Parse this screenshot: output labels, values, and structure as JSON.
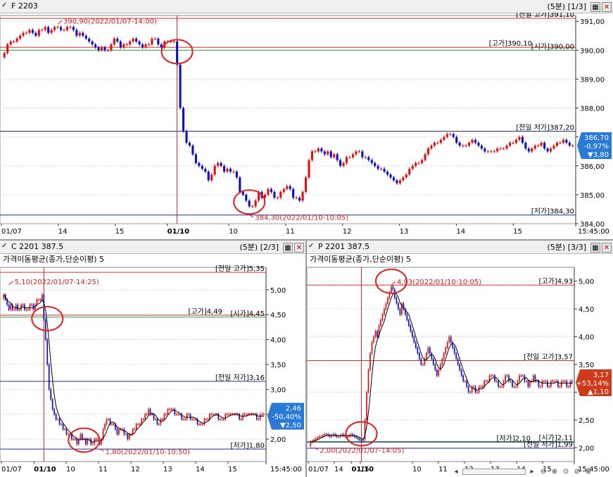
{
  "colors": {
    "up": "#e01010",
    "down": "#1010c0",
    "grid": "#c8c8c8",
    "hline_red": "#e03030",
    "hline_blue": "#2030a0",
    "hline_green": "#30a030",
    "vline": "#d02020",
    "circle": "#e02020",
    "badge_down": "#2979d6",
    "badge_up": "#d03a1a",
    "ma": "#000000"
  },
  "panels": [
    {
      "id": "f2203",
      "title": "F 2203",
      "period": "(5분)",
      "page": "[1/3]",
      "legend": "",
      "ylim": [
        384.0,
        391.2
      ],
      "yticks": [
        384.0,
        385.0,
        386.0,
        387.0,
        388.0,
        389.0,
        390.0,
        391.0
      ],
      "ytick_labels": [
        "384,00",
        "385,00",
        "386,00",
        "387,00",
        "388,00",
        "389,00",
        "390,00",
        "391,00"
      ],
      "xlabels": [
        "01/07",
        "14",
        "15",
        "01/10",
        "10",
        "11",
        "12",
        "13",
        "14",
        "15",
        "15:45:00"
      ],
      "xlabel_bold_index": 3,
      "n_candles": 180,
      "vline_index": 55,
      "hlines": [
        {
          "value": 391.1,
          "color": "hline_red",
          "label": "[전일 고가]391,10"
        },
        {
          "value": 390.1,
          "color": "hline_red",
          "label": "[고가]390,10"
        },
        {
          "value": 390.0,
          "color": "hline_green",
          "label": "[시가]390,00"
        },
        {
          "value": 387.2,
          "color": "hline_blue",
          "label": "[전일 저가]387,20"
        },
        {
          "value": 384.3,
          "color": "hline_blue",
          "label": "[저가]384,30"
        }
      ],
      "annotations": [
        {
          "text": "390,90(2022/01/07-14:00)",
          "at": 17,
          "value": 390.9,
          "side": "above"
        },
        {
          "text": "384,30(2022/01/10-10:05)",
          "at": 78,
          "value": 384.3,
          "side": "below"
        }
      ],
      "circles": [
        {
          "at": 55,
          "value": 389.95
        },
        {
          "at": 78,
          "value": 384.75
        }
      ],
      "badge": {
        "lines": [
          "386,70",
          "-0,97%",
          "▼3,80"
        ],
        "value": 386.7,
        "style": "badge_down"
      },
      "chart_data": {
        "type": "candlestick",
        "series": [
          {
            "values": [
              389.9,
              390.2,
              390.3,
              390.3,
              390.4,
              390.5,
              390.6,
              390.6,
              390.7,
              390.6,
              390.5,
              390.7,
              390.7,
              390.8,
              390.6,
              390.7,
              390.8,
              390.8,
              390.7,
              390.7,
              390.8,
              390.8,
              390.7,
              390.5,
              390.6,
              390.5,
              390.4,
              390.3,
              390.2,
              390.1,
              390.0,
              390.1,
              390.0,
              390.0,
              390.2,
              390.4,
              390.3,
              390.1,
              390.2,
              390.2,
              390.3,
              390.4,
              390.3,
              390.2,
              390.1,
              390.2,
              390.2,
              390.4,
              390.4,
              390.2,
              390.1,
              390.3,
              390.3,
              390.3,
              390.3,
              389.5,
              388.0,
              387.2,
              386.8,
              386.7,
              386.4,
              386.1,
              386.0,
              385.9,
              385.8,
              385.5,
              385.7,
              386.0,
              386.1,
              386.0,
              385.8,
              385.9,
              385.8,
              385.8,
              385.6,
              385.1,
              385.0,
              384.8,
              384.6,
              384.6,
              384.8,
              385.1,
              384.9,
              385.0,
              385.2,
              385.1,
              384.9,
              384.9,
              385.1,
              385.2,
              385.3,
              385.2,
              384.9,
              384.9,
              384.8,
              385.1,
              385.6,
              386.2,
              386.5,
              386.5,
              386.6,
              386.5,
              386.4,
              386.5,
              386.3,
              386.4,
              386.2,
              386.0,
              386.1,
              386.3,
              386.3,
              386.4,
              386.5,
              386.5,
              386.3,
              386.3,
              386.2,
              386.1,
              386.0,
              385.9,
              385.9,
              385.8,
              385.7,
              385.6,
              385.5,
              385.4,
              385.5,
              385.6,
              385.7,
              385.9,
              386.0,
              386.1,
              386.1,
              386.2,
              386.4,
              386.6,
              386.7,
              386.8,
              386.8,
              386.9,
              387.0,
              387.1,
              387.1,
              387.0,
              386.8,
              386.7,
              386.7,
              386.7,
              386.8,
              386.9,
              386.8,
              386.7,
              386.6,
              386.5,
              386.5,
              386.5,
              386.5,
              386.6,
              386.6,
              386.6,
              386.7,
              386.8,
              386.8,
              386.9,
              387.0,
              386.8,
              386.6,
              386.5,
              386.6,
              386.7,
              386.7,
              386.8,
              386.6,
              386.5,
              386.6,
              386.7,
              386.8,
              386.8,
              386.9,
              386.8,
              386.7,
              386.7
            ]
          }
        ]
      }
    },
    {
      "id": "c2201",
      "title": "C 2201  387.5",
      "period": "(5분)",
      "page": "[2/3]",
      "legend": "가격이동평균(종가,단순이평) 5",
      "ylim": [
        1.55,
        5.45
      ],
      "yticks": [
        2.0,
        2.5,
        3.0,
        3.5,
        4.0,
        4.5,
        5.0
      ],
      "ytick_labels": [
        "2,00",
        "2,50",
        "3,00",
        "3,50",
        "4,00",
        "4,50",
        "5,00"
      ],
      "xlabels": [
        "01/07",
        "01/10",
        "10",
        "11",
        "12",
        "13",
        "14",
        "15",
        "15:45:00"
      ],
      "xlabel_bold_index": 1,
      "n_candles": 150,
      "vline_index": 23,
      "hlines": [
        {
          "value": 5.35,
          "color": "hline_red",
          "label": "[전일 고가]5,35"
        },
        {
          "value": 4.49,
          "color": "hline_red",
          "label": "[고가]4,49"
        },
        {
          "value": 4.45,
          "color": "hline_green",
          "label": "[시가]4,45"
        },
        {
          "value": 3.16,
          "color": "hline_blue",
          "label": "[전일 저가]3,16"
        },
        {
          "value": 1.8,
          "color": "hline_blue",
          "label": "[저가]1,80"
        }
      ],
      "annotations": [
        {
          "text": "5,10(2022/01/07-14:25)",
          "at": 3,
          "value": 5.1,
          "side": "above"
        },
        {
          "text": "1,80(2022/01/10-10:50)",
          "at": 55,
          "value": 1.8,
          "side": "below"
        }
      ],
      "circles": [
        {
          "at": 25,
          "value": 4.42
        },
        {
          "at": 46,
          "value": 1.98
        }
      ],
      "badge": {
        "lines": [
          "2,46",
          "-50,40%",
          "▼2,50"
        ],
        "value": 2.46,
        "style": "badge_down"
      },
      "chart_data": {
        "type": "candlestick",
        "series": [
          {
            "values": [
              4.9,
              4.8,
              4.7,
              4.6,
              4.7,
              4.6,
              4.6,
              4.7,
              4.6,
              4.6,
              4.7,
              4.7,
              4.6,
              4.6,
              4.6,
              4.7,
              4.7,
              4.6,
              4.7,
              4.8,
              4.8,
              4.8,
              4.9,
              4.4,
              4.0,
              3.5,
              3.0,
              2.8,
              2.6,
              2.5,
              2.4,
              2.4,
              2.3,
              2.3,
              2.2,
              2.2,
              2.1,
              2.1,
              2.1,
              2.0,
              2.0,
              2.0,
              1.9,
              2.0,
              2.1,
              2.0,
              2.0,
              1.9,
              2.0,
              2.0,
              1.9,
              1.9,
              2.0,
              2.0,
              2.0,
              1.9,
              2.0,
              2.2,
              2.3,
              2.4,
              2.4,
              2.3,
              2.3,
              2.3,
              2.2,
              2.1,
              2.2,
              2.2,
              2.2,
              2.1,
              2.1,
              2.0,
              2.1,
              2.1,
              2.2,
              2.2,
              2.3,
              2.3,
              2.3,
              2.4,
              2.4,
              2.5,
              2.5,
              2.6,
              2.5,
              2.5,
              2.4,
              2.4,
              2.3,
              2.3,
              2.4,
              2.4,
              2.5,
              2.5,
              2.6,
              2.6,
              2.6,
              2.6,
              2.5,
              2.5,
              2.5,
              2.5,
              2.4,
              2.4,
              2.4,
              2.5,
              2.5,
              2.4,
              2.4,
              2.4,
              2.4,
              2.3,
              2.3,
              2.3,
              2.3,
              2.4,
              2.4,
              2.4,
              2.5,
              2.5,
              2.5,
              2.5,
              2.5,
              2.4,
              2.4,
              2.4,
              2.4,
              2.5,
              2.5,
              2.5,
              2.5,
              2.5,
              2.5,
              2.5,
              2.5,
              2.4,
              2.4,
              2.5,
              2.5,
              2.5,
              2.5,
              2.5,
              2.5,
              2.5,
              2.5,
              2.4,
              2.4,
              2.5,
              2.5,
              2.5
            ]
          }
        ]
      }
    },
    {
      "id": "p2201",
      "title": "P 2201  387.5",
      "period": "(5분)",
      "page": "[3/3]",
      "legend": "가격이동평균(종가,단순이평) 5",
      "ylim": [
        1.75,
        5.25
      ],
      "yticks": [
        2.0,
        2.5,
        3.0,
        3.5,
        4.0,
        4.5,
        5.0
      ],
      "ytick_labels": [
        "2,00",
        "2,50",
        "3,00",
        "3,50",
        "4,00",
        "4,50",
        "5,00"
      ],
      "xlabels": [
        "01/07",
        "14",
        "15",
        "01/10",
        "10",
        "11",
        "12",
        "13",
        "14",
        "15",
        "15:45:00"
      ],
      "xlabel_bold_index": 3,
      "n_candles": 150,
      "vline_index": 29,
      "hlines": [
        {
          "value": 4.93,
          "color": "hline_red",
          "label": "[고가]4,93"
        },
        {
          "value": 3.57,
          "color": "hline_red",
          "label": "[전일 고가]3,57"
        },
        {
          "value": 2.11,
          "color": "hline_green",
          "label": "[시가]2,11"
        },
        {
          "value": 2.1,
          "color": "hline_blue",
          "label": "[저가]2,10"
        },
        {
          "value": 1.99,
          "color": "hline_blue",
          "label": "[전일 저가]1,99"
        }
      ],
      "annotations": [
        {
          "text": "4,93(2022/01/10-10:05)",
          "at": 46,
          "value": 4.93,
          "side": "above"
        },
        {
          "text": "2,00(2022/01/07-14:05)",
          "at": 2,
          "value": 2.0,
          "side": "below"
        }
      ],
      "circles": [
        {
          "at": 29,
          "value": 2.25
        },
        {
          "at": 46,
          "value": 5.0
        }
      ],
      "badge": {
        "lines": [
          "3,17",
          "+53,14%",
          "▲1,10"
        ],
        "value": 3.17,
        "style": "badge_up"
      },
      "chart_data": {
        "type": "candlestick",
        "series": [
          {
            "values": [
              2.1,
              2.12,
              2.14,
              2.16,
              2.18,
              2.2,
              2.2,
              2.22,
              2.24,
              2.24,
              2.22,
              2.2,
              2.22,
              2.24,
              2.22,
              2.2,
              2.2,
              2.22,
              2.24,
              2.22,
              2.2,
              2.2,
              2.22,
              2.24,
              2.22,
              2.2,
              2.18,
              2.16,
              2.14,
              2.12,
              2.15,
              2.5,
              3.0,
              3.4,
              3.7,
              3.9,
              4.0,
              4.1,
              4.0,
              4.2,
              4.3,
              4.4,
              4.5,
              4.6,
              4.7,
              4.8,
              4.9,
              4.85,
              4.7,
              4.6,
              4.5,
              4.4,
              4.6,
              4.5,
              4.4,
              4.3,
              4.2,
              4.1,
              4.0,
              3.9,
              3.8,
              3.7,
              3.6,
              3.5,
              3.5,
              3.6,
              3.7,
              3.8,
              3.7,
              3.6,
              3.5,
              3.4,
              3.3,
              3.4,
              3.5,
              3.6,
              3.7,
              3.8,
              3.9,
              4.0,
              3.9,
              3.8,
              3.7,
              3.6,
              3.5,
              3.4,
              3.3,
              3.2,
              3.2,
              3.1,
              3.0,
              3.0,
              3.1,
              3.1,
              3.0,
              3.0,
              3.1,
              3.1,
              3.1,
              3.2,
              3.2,
              3.2,
              3.3,
              3.3,
              3.3,
              3.2,
              3.2,
              3.1,
              3.1,
              3.1,
              3.2,
              3.3,
              3.3,
              3.2,
              3.2,
              3.1,
              3.1,
              3.1,
              3.2,
              3.3,
              3.3,
              3.3,
              3.2,
              3.2,
              3.1,
              3.2,
              3.2,
              3.3,
              3.2,
              3.2,
              3.1,
              3.1,
              3.2,
              3.2,
              3.2,
              3.1,
              3.1,
              3.2,
              3.2,
              3.2,
              3.2,
              3.1,
              3.1,
              3.2,
              3.2,
              3.2,
              3.1,
              3.1,
              3.2,
              3.17
            ]
          }
        ]
      }
    }
  ]
}
